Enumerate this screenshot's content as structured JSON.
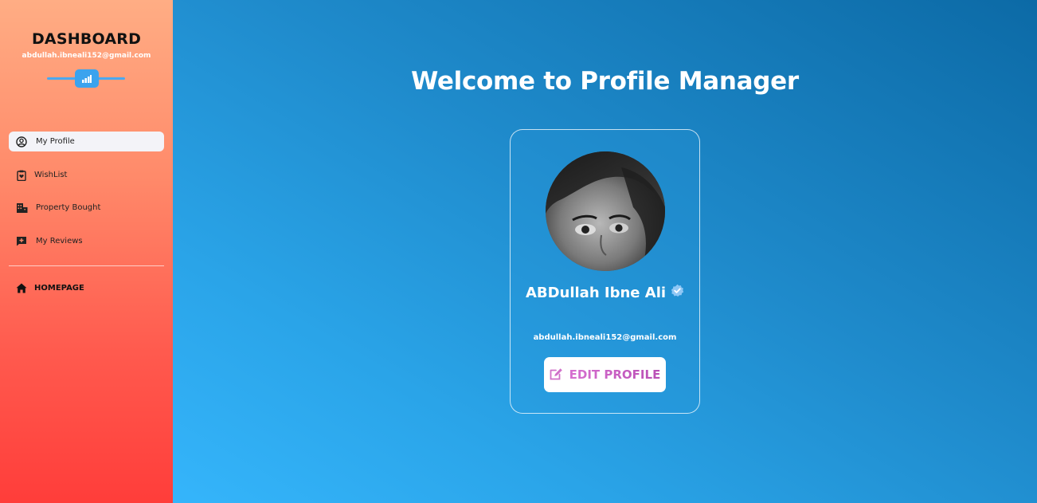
{
  "sidebar": {
    "title": "DASHBOARD",
    "email": "abdullah.ibneali152@gmail.com",
    "logo_icon": "chart-bar-icon",
    "items": [
      {
        "label": "My Profile",
        "icon": "user-circle-icon",
        "active": true
      },
      {
        "label": "WishList",
        "icon": "clipboard-heart-icon",
        "active": false
      },
      {
        "label": "Property Bought",
        "icon": "building-icon",
        "active": false
      },
      {
        "label": "My Reviews",
        "icon": "review-icon",
        "active": false
      }
    ],
    "home": {
      "label": "HOMEPAGE",
      "icon": "home-icon"
    }
  },
  "main": {
    "title": "Welcome to Profile Manager",
    "profile": {
      "name": "ABDullah Ibne Ali",
      "verified_icon": "verified-badge-icon",
      "email": "abdullah.ibneali152@gmail.com",
      "edit_label": "EDIT PROFILE",
      "edit_icon": "edit-icon"
    }
  },
  "colors": {
    "sidebar_top": "#ffad84",
    "sidebar_bottom": "#ff3d3a",
    "main_accent": "#1f8bcc",
    "edit_text": "#c95cc4",
    "verified": "#8fc7f5"
  }
}
